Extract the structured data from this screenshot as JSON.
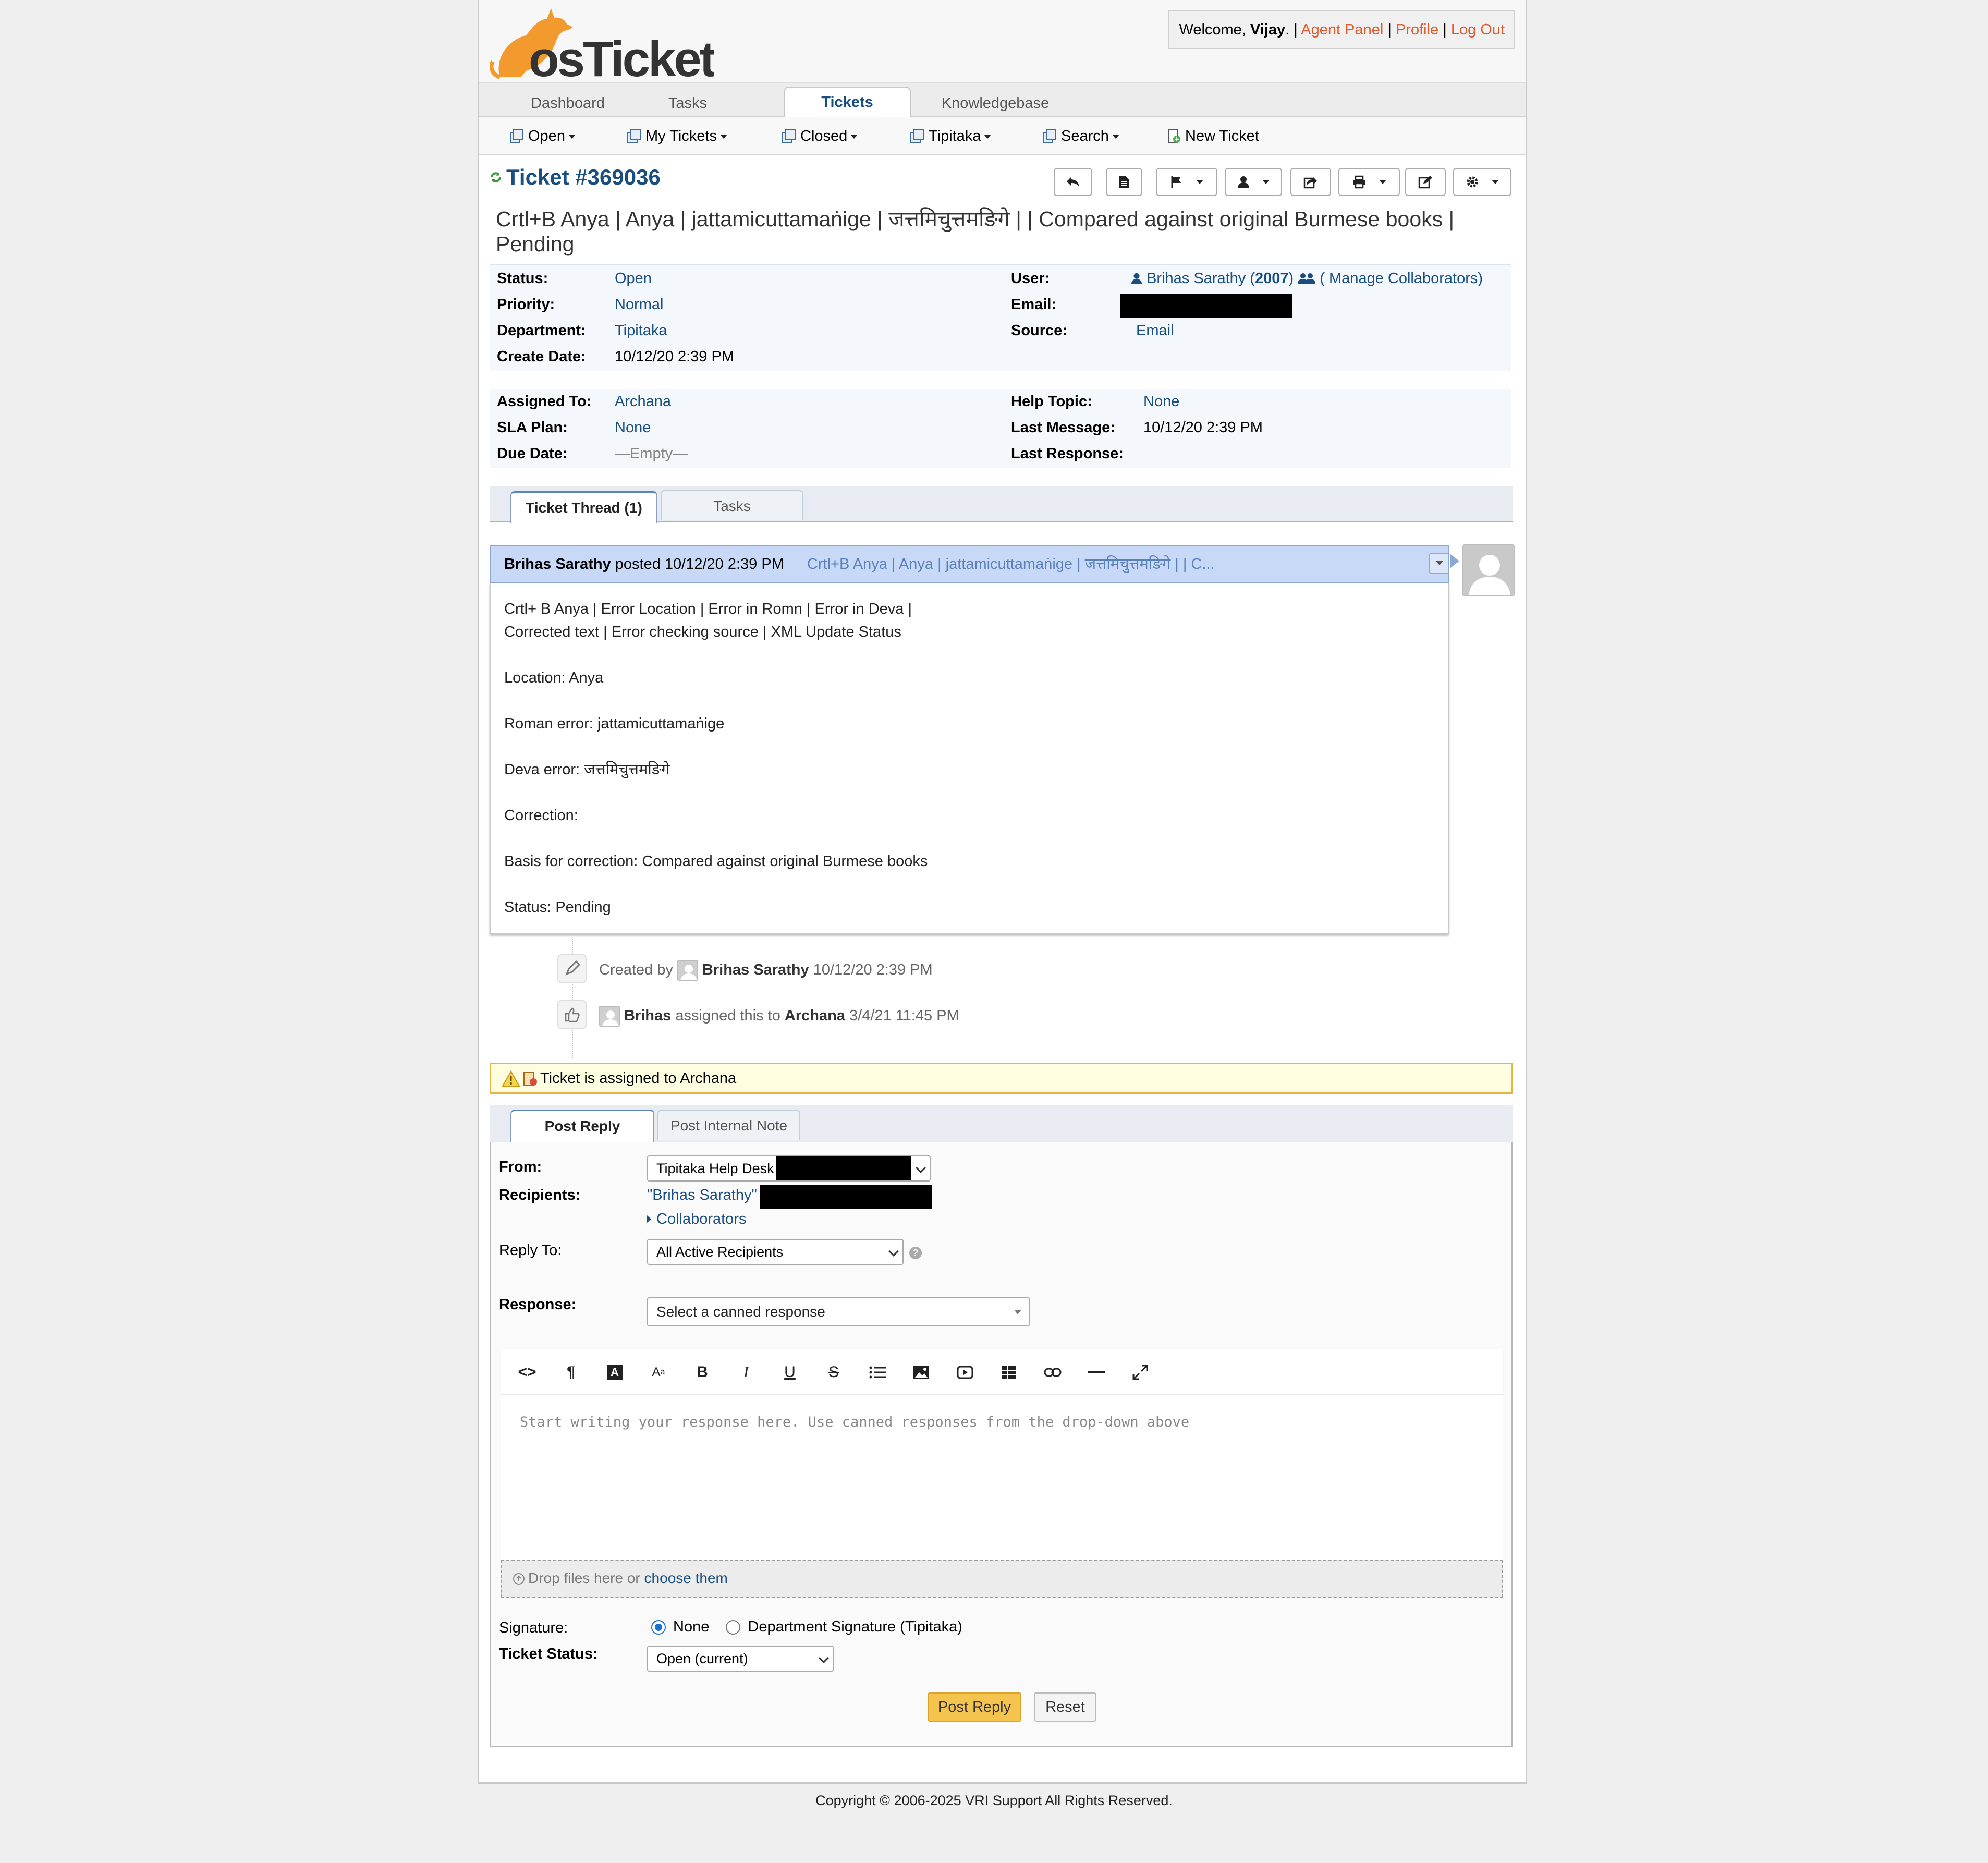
{
  "header": {
    "logo_text": "osTicket",
    "welcome_prefix": "Welcome, ",
    "username": "Vijay",
    "welcome_suffix": ". |",
    "agent_panel": "Agent Panel",
    "profile": "Profile",
    "logout": "Log Out",
    "sep": "|"
  },
  "nav": {
    "tabs": [
      "Dashboard",
      "Tasks",
      "Tickets",
      "Knowledgebase"
    ],
    "active": "Tickets"
  },
  "subnav": {
    "items": [
      "Open",
      "My Tickets",
      "Closed",
      "Tipitaka",
      "Search",
      "New Ticket"
    ]
  },
  "ticket": {
    "number": "Ticket #369036",
    "subject": "Crtl+B Anya | Anya | jattamicuttamaṅige | जत्तमिचुत्तमङिगे | | Compared against original Burmese books | Pending",
    "status_label": "Status:",
    "status": "Open",
    "priority_label": "Priority:",
    "priority": "Normal",
    "department_label": "Department:",
    "department": "Tipitaka",
    "create_date_label": "Create Date:",
    "create_date": "10/12/20 2:39 PM",
    "user_label": "User:",
    "user": "Brihas Sarathy",
    "user_paren_open": "(",
    "user_count": "2007",
    "user_paren_close": ")",
    "manage_collaborators": "( Manage Collaborators)",
    "email_label": "Email:",
    "source_label": "Source:",
    "source": "Email",
    "assigned_label": "Assigned To:",
    "assigned": "Archana",
    "sla_label": "SLA Plan:",
    "sla": "None",
    "due_label": "Due Date:",
    "due": "—Empty—",
    "help_topic_label": "Help Topic:",
    "help_topic": "None",
    "last_message_label": "Last Message:",
    "last_message": "10/12/20 2:39 PM",
    "last_response_label": "Last Response:"
  },
  "thread_tabs": {
    "thread": "Ticket Thread (1)",
    "tasks": "Tasks"
  },
  "entry": {
    "author": "Brihas Sarathy",
    "posted": " posted ",
    "date": "10/12/20 2:39 PM",
    "title": "Crtl+B Anya | Anya | jattamicuttamaṅige | जत्तमिचुत्तमङिगे | | C...",
    "body": [
      "Crtl+ B Anya | Error Location | Error in Romn | Error in Deva |",
      "Corrected text | Error checking source | XML Update Status",
      "Location: Anya",
      "Roman error: jattamicuttamaṅige",
      "Deva error: जत्तमिचुत्तमङिगे",
      "Correction:",
      "Basis for correction: Compared against original Burmese books",
      "Status: Pending"
    ]
  },
  "events": {
    "created_by": "Created by",
    "created_user": "Brihas Sarathy",
    "created_date": "10/12/20 2:39 PM",
    "assign_user": "Brihas",
    "assign_text": "assigned this to",
    "assign_target": "Archana",
    "assign_date": "3/4/21 11:45 PM"
  },
  "notice": "Ticket is assigned to Archana",
  "reply": {
    "tabs": [
      "Post Reply",
      "Post Internal Note"
    ],
    "from_label": "From:",
    "from_value": "Tipitaka Help Desk",
    "recipients_label": "Recipients:",
    "recipients_value": "\"Brihas Sarathy\"",
    "collaborators": "Collaborators",
    "reply_to_label": "Reply To:",
    "reply_to_value": "All Active Recipients",
    "response_label": "Response:",
    "response_placeholder": "Select a canned response",
    "editor_placeholder": "Start writing your response here. Use canned responses from the drop-down above",
    "drop_text": "Drop files here or ",
    "drop_link": "choose them",
    "signature_label": "Signature:",
    "sig_none": "None",
    "sig_dept": "Department Signature (Tipitaka)",
    "ticket_status_label": "Ticket Status:",
    "ticket_status_value": "Open (current)",
    "post_button": "Post Reply",
    "reset_button": "Reset"
  },
  "footer": "Copyright © 2006-2025 VRI Support All Rights Reserved.",
  "colors": {
    "brand_blue": "#184e81",
    "link_orange": "#e0592a",
    "primary_button": "#f5c44e"
  }
}
